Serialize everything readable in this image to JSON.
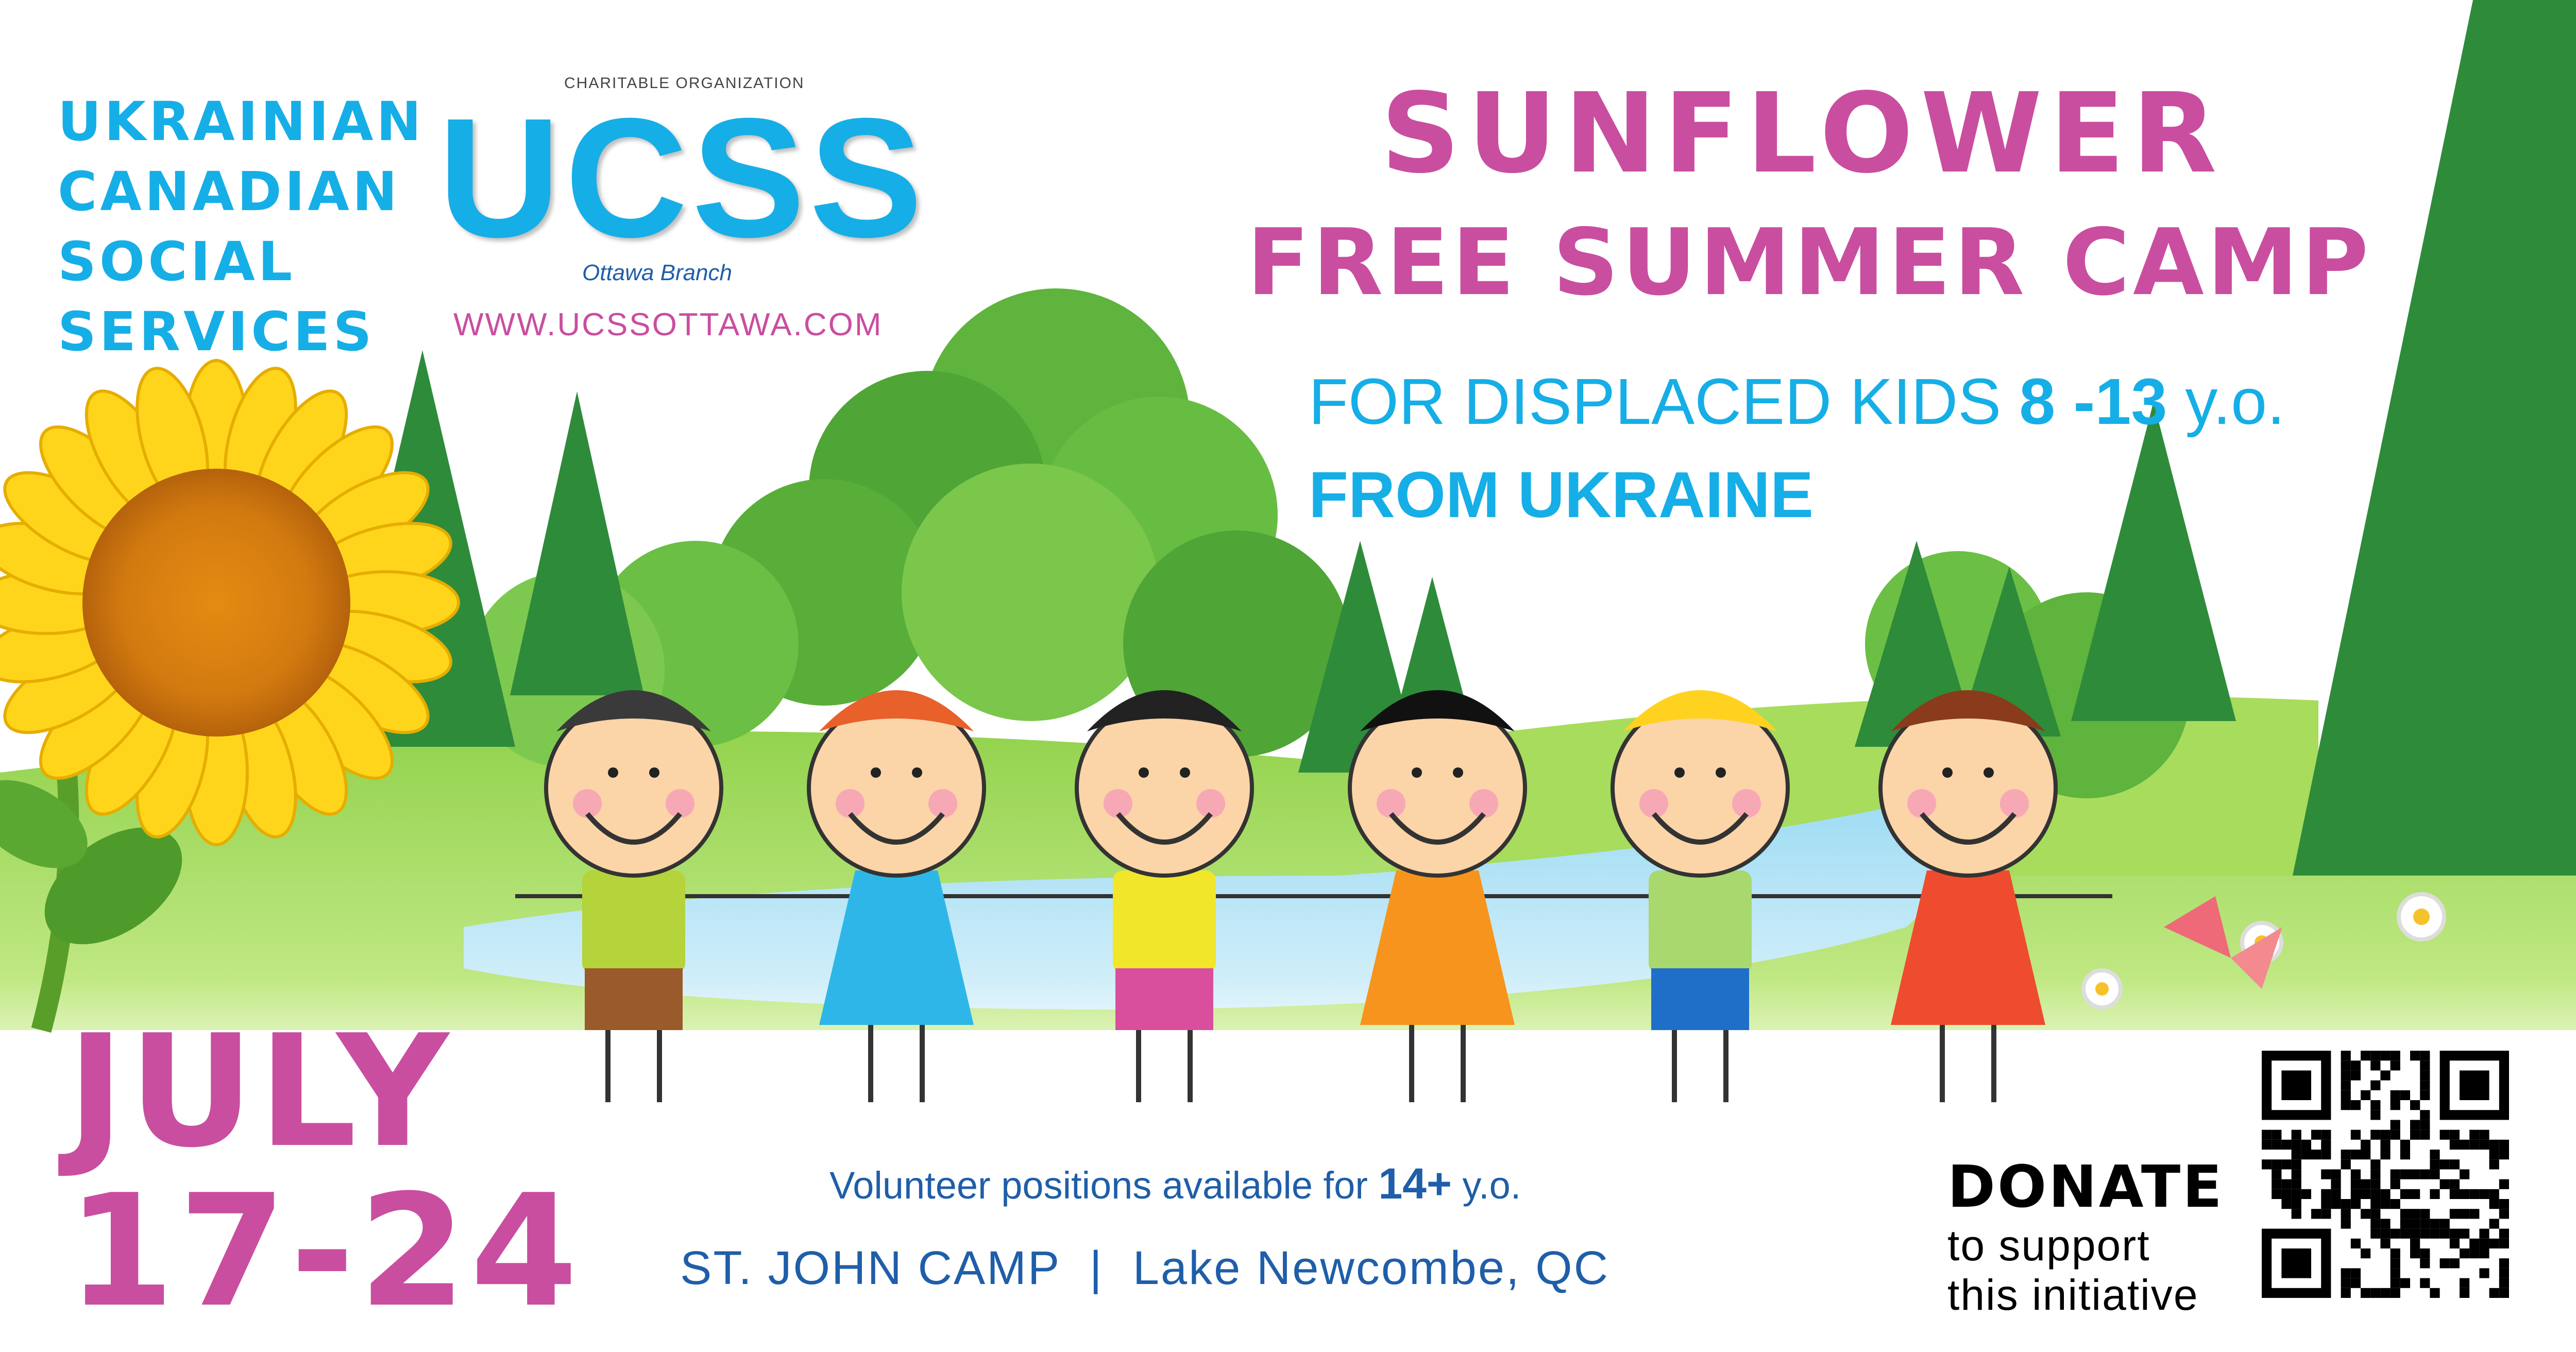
{
  "organization": {
    "name_lines": [
      "UKRAINIAN",
      "CANADIAN",
      "SOCIAL",
      "SERVICES"
    ],
    "tagline": "CHARITABLE ORGANIZATION",
    "logo": "UCSS",
    "branch": "Ottawa Branch",
    "website": "WWW.UCSSOTTAWA.COM"
  },
  "headline": {
    "line1": "SUNFLOWER",
    "line2": "FREE SUMMER CAMP",
    "audience_prefix": "FOR DISPLACED KIDS ",
    "age_range": "8 -13",
    "age_suffix": " y.o.",
    "origin": "FROM UKRAINE"
  },
  "dates": {
    "month": "JULY",
    "days": "17-24"
  },
  "volunteer": {
    "prefix": "Volunteer positions available for ",
    "age": "14+",
    "suffix": " y.o."
  },
  "location": "ST. JOHN CAMP  |  Lake Newcombe, QC",
  "donate": {
    "title": "DONATE",
    "line1": "to support",
    "line2": "this initiative"
  },
  "colors": {
    "magenta": "#c94ea0",
    "cyan": "#16aee6",
    "navy": "#1f5ea8"
  }
}
